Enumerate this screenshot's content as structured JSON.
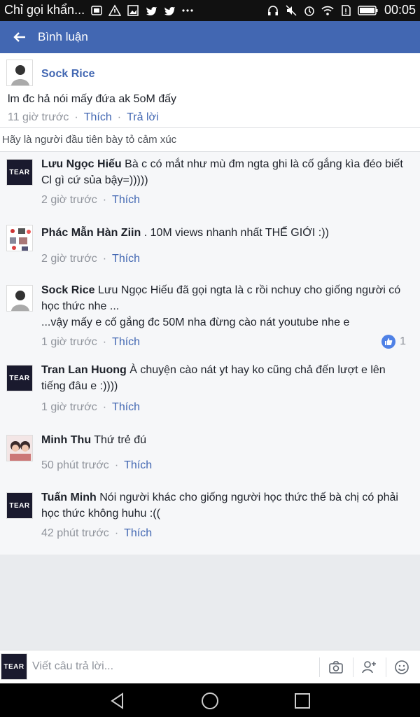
{
  "status_bar": {
    "notification_text": "Chỉ gọi khẩn...",
    "time": "00:05"
  },
  "app_bar": {
    "title": "Bình luận"
  },
  "post": {
    "author": "Sock Rice",
    "text": "lm đc hả nói mấy đứa ak 5oM đấy",
    "time": "11 giờ trước",
    "like_label": "Thích",
    "reply_label": "Trả lời"
  },
  "reaction_prompt": "Hãy là người đầu tiên bày tỏ cảm xúc",
  "comments": [
    {
      "author": "Lưu Ngọc Hiếu",
      "text": "Bà c có mắt như mù đm ngta ghi là cố gắng kìa đéo biết Cl gì cứ sủa bậy=)))))",
      "time": "2 giờ trước",
      "like_label": "Thích",
      "avatar": "tear"
    },
    {
      "author": "Phác Mẫn Hàn Ziin",
      "text": ". 10M views nhanh nhất THẾ GIỚI :))",
      "time": "2 giờ trước",
      "like_label": "Thích",
      "avatar": "collage"
    },
    {
      "author": "Sock Rice",
      "text": "Lưu Ngọc Hiếu đã gọi ngta là c rồi nchuy cho giống người có học thức nhe ...\n...vậy mấy e cố gắng đc 50M nha đừng cào nát youtube nhe e",
      "time": "1 giờ trước",
      "like_label": "Thích",
      "like_count": "1",
      "avatar": "person"
    },
    {
      "author": "Tran Lan Huong",
      "text": "À chuyện cào nát yt hay ko cũng chả đến lượt e lên tiếng đâu e :))))",
      "time": "1 giờ trước",
      "like_label": "Thích",
      "avatar": "tear"
    },
    {
      "author": "Minh Thu",
      "text": "Thứ trẻ đú",
      "time": "50 phút trước",
      "like_label": "Thích",
      "avatar": "people"
    },
    {
      "author": "Tuấn Minh",
      "text": "Nói người khác cho giống người học thức thế bà chị có phải học thức không huhu :((",
      "time": "42 phút trước",
      "like_label": "Thích",
      "avatar": "tear"
    }
  ],
  "avatar_label": "TEAR",
  "composer": {
    "placeholder": "Viết câu trả lời..."
  },
  "colors": {
    "brand": "#4267b2",
    "link": "#4267b2",
    "meta": "#90949c",
    "like_badge": "#4f81e6"
  },
  "icons": [
    "back-arrow-icon",
    "camera-icon",
    "add-person-icon",
    "emoji-icon",
    "nav-back-icon",
    "nav-home-icon",
    "nav-recents-icon",
    "thumbs-up-icon"
  ]
}
